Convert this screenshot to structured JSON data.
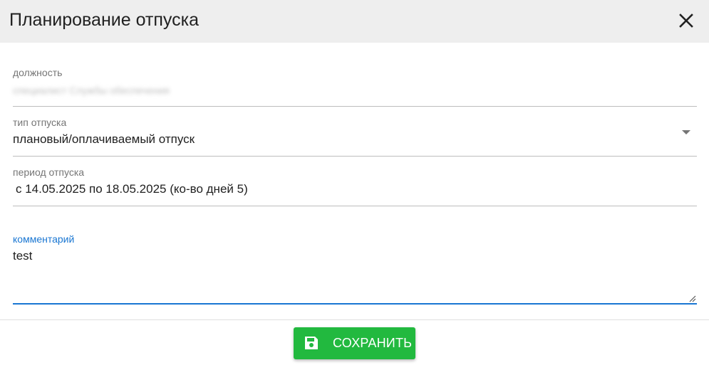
{
  "dialog": {
    "title": "Планирование отпуска"
  },
  "icons": {
    "close": "close-icon",
    "dropdown": "chevron-down-icon",
    "save": "floppy-disk-icon",
    "resize": "resize-handle-icon"
  },
  "fields": {
    "position": {
      "label": "должность",
      "value": "специалист Службы обеспечения"
    },
    "vacation_type": {
      "label": "тип отпуска",
      "value": "плановый/оплачиваемый отпуск"
    },
    "period": {
      "label": "период отпуска",
      "value": "с 14.05.2025 по 18.05.2025 (ко-во дней 5)"
    },
    "comment": {
      "label": "комментарий",
      "value": "test"
    }
  },
  "actions": {
    "save_label": "СОХРАНИТЬ"
  },
  "colors": {
    "header_bg": "#eeeeee",
    "accent": "#1976d2",
    "save_button": "#22b93f",
    "muted_text": "#757575"
  }
}
